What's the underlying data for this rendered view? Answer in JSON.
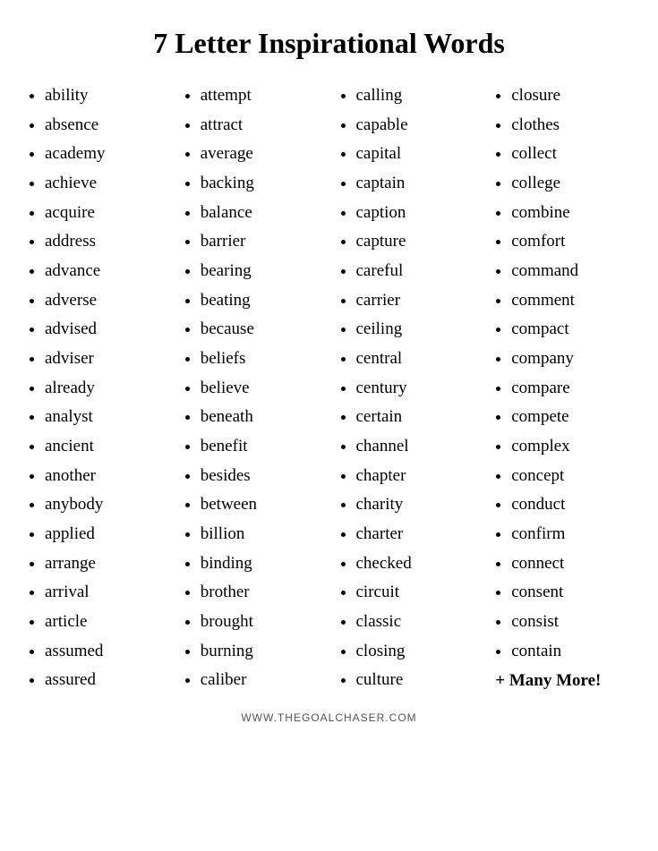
{
  "title": "7 Letter Inspirational Words",
  "columns": [
    {
      "words": [
        "ability",
        "absence",
        "academy",
        "achieve",
        "acquire",
        "address",
        "advance",
        "adverse",
        "advised",
        "adviser",
        "already",
        "analyst",
        "ancient",
        "another",
        "anybody",
        "applied",
        "arrange",
        "arrival",
        "article",
        "assumed",
        "assured"
      ]
    },
    {
      "words": [
        "attempt",
        "attract",
        "average",
        "backing",
        "balance",
        "barrier",
        "bearing",
        "beating",
        "because",
        "beliefs",
        "believe",
        "beneath",
        "benefit",
        "besides",
        "between",
        "billion",
        "binding",
        "brother",
        "brought",
        "burning",
        "caliber"
      ]
    },
    {
      "words": [
        "calling",
        "capable",
        "capital",
        "captain",
        "caption",
        "capture",
        "careful",
        "carrier",
        "ceiling",
        "central",
        "century",
        "certain",
        "channel",
        "chapter",
        "charity",
        "charter",
        "checked",
        "circuit",
        "classic",
        "closing",
        "culture"
      ]
    },
    {
      "words": [
        "closure",
        "clothes",
        "collect",
        "college",
        "combine",
        "comfort",
        "command",
        "comment",
        "compact",
        "company",
        "compare",
        "compete",
        "complex",
        "concept",
        "conduct",
        "confirm",
        "connect",
        "consent",
        "consist",
        "contain"
      ],
      "extra": "+ Many More!"
    }
  ],
  "footer": "www.thegoalchaser.com"
}
